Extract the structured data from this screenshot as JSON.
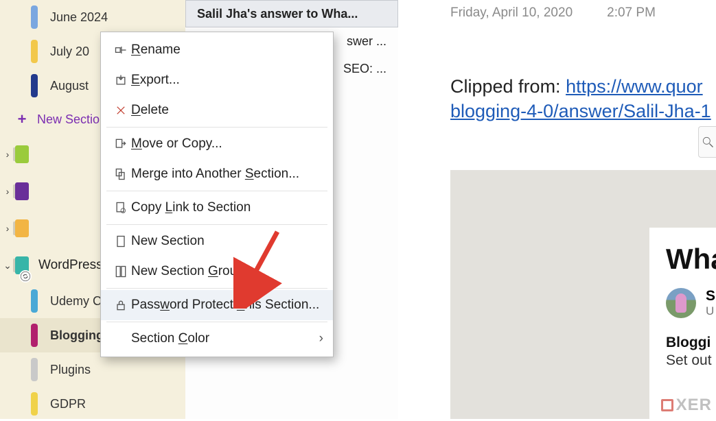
{
  "sidebar": {
    "months": [
      {
        "label": "June 2024",
        "color": "#7aa7e0"
      },
      {
        "label": "July 20",
        "color": "#f2c84b"
      },
      {
        "label": "August",
        "color": "#233a8c"
      }
    ],
    "new_section": "New Sectio",
    "notebooks": [
      {
        "label": "",
        "color": "#9acb3c",
        "chev": "›",
        "sync": false
      },
      {
        "label": "",
        "color": "#6a2f99",
        "chev": "›",
        "sync": false
      },
      {
        "label": "",
        "color": "#f2b544",
        "chev": "›",
        "sync": false
      },
      {
        "label": "WordPress",
        "color": "#38b5a8",
        "chev": "⌄",
        "sync": true
      }
    ],
    "sections": [
      {
        "label": "Udemy Co",
        "color": "#4aa9d6"
      },
      {
        "label": "Blogging Tips",
        "color": "#b1206d",
        "bold": true,
        "selected": true
      },
      {
        "label": "Plugins",
        "color": "#c9c9c9"
      },
      {
        "label": "GDPR",
        "color": "#f0d24a"
      }
    ]
  },
  "pages": {
    "items": [
      {
        "title": "Salil Jha's answer to Wha...",
        "active": true
      },
      {
        "title": "swer ..."
      },
      {
        "title": "SEO: ..."
      }
    ]
  },
  "content": {
    "date": "Friday, April 10, 2020",
    "time": "2:07 PM",
    "clipped_label": "Clipped from: ",
    "link_line1": "https://www.quor",
    "link_line2": "blogging-4-0/answer/Salil-Jha-1",
    "card_title": "Wha",
    "card_author_initial": "S",
    "card_sub": "U",
    "card_bold": "Bloggi",
    "card_line": "Set out",
    "watermark": "XER"
  },
  "context_menu": {
    "rename": "ename",
    "export": "xport...",
    "delete": "elete",
    "move": "ove or Copy...",
    "merge_a": "Merge into Another ",
    "merge_b": "ection...",
    "copylink_a": "Copy ",
    "copylink_b": "ink to Section",
    "newsection": "New Section",
    "newgroup_a": "New Section ",
    "newgroup_b": "roup",
    "password_a": "Pass",
    "password_b": "ord Protect ",
    "password_c": "his Section...",
    "color_a": "Section ",
    "color_b": "olor"
  }
}
